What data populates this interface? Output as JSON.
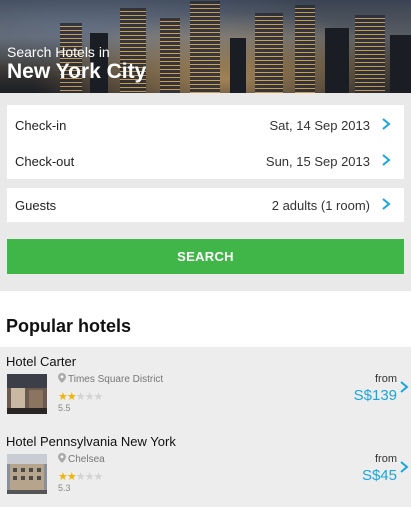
{
  "hero": {
    "subtitle": "Search Hotels in",
    "city": "New York City"
  },
  "dates": {
    "checkin_label": "Check-in",
    "checkin_value": "Sat, 14 Sep 2013",
    "checkout_label": "Check-out",
    "checkout_value": "Sun, 15 Sep 2013"
  },
  "guests": {
    "label": "Guests",
    "value": "2 adults (1 room)"
  },
  "search_button": "SEARCH",
  "popular": {
    "title": "Popular hotels",
    "hotels": [
      {
        "name": "Hotel Carter",
        "location": "Times Square District",
        "stars": 2,
        "score": "5.5",
        "from_label": "from",
        "price": "S$139"
      },
      {
        "name": "Hotel Pennsylvania New York",
        "location": "Chelsea",
        "stars": 2,
        "score": "5.3",
        "from_label": "from",
        "price": "S$45"
      }
    ]
  },
  "colors": {
    "accent_green": "#41b648",
    "price_blue": "#1aa6d9",
    "star_gold": "#f0b400"
  },
  "icons": [
    "chevron-right-icon",
    "location-pin-icon",
    "star-icon"
  ]
}
